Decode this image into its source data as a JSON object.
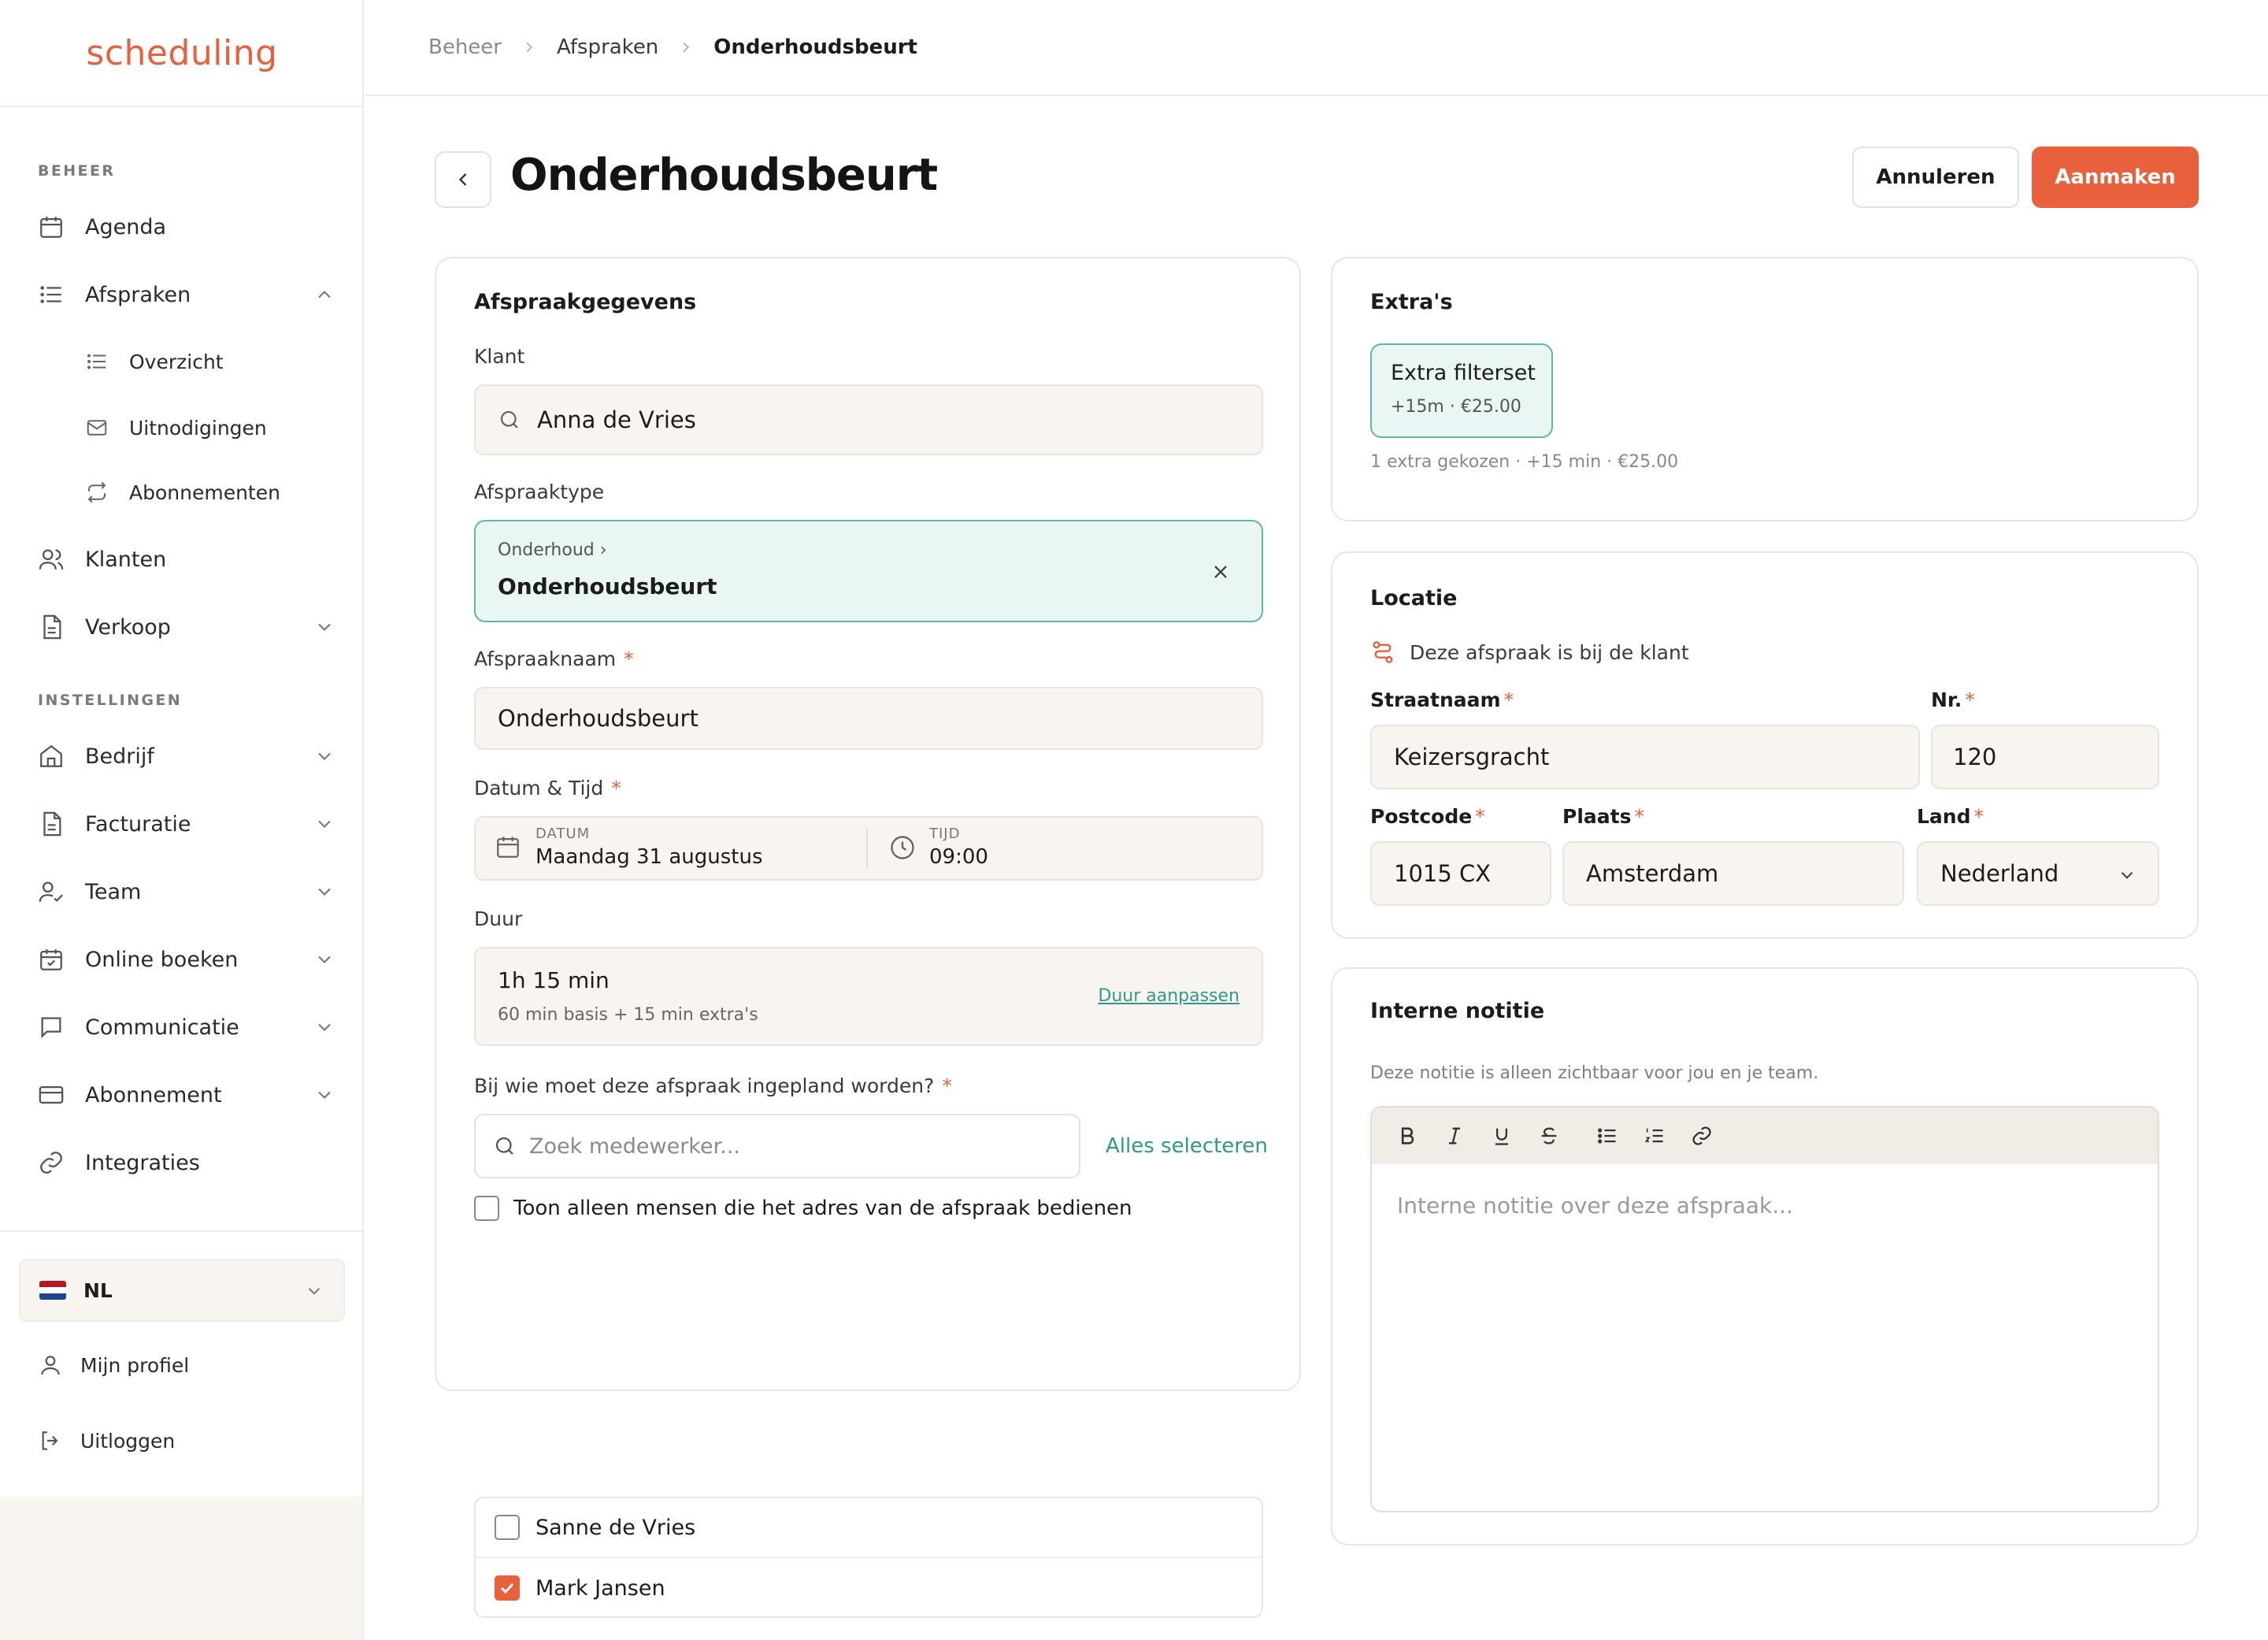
{
  "brand": {
    "logo_text": "scheduling",
    "accent": "#e8603c",
    "teal": "#5eb8a4"
  },
  "sidebar": {
    "section_beheer": "BEHEER",
    "section_instellingen": "INSTELLINGEN",
    "items": {
      "agenda": "Agenda",
      "afspraken": "Afspraken",
      "overzicht": "Overzicht",
      "uitnodigingen": "Uitnodigingen",
      "abonnementen": "Abonnementen",
      "klanten": "Klanten",
      "verkoop": "Verkoop",
      "bedrijf": "Bedrijf",
      "facturatie": "Facturatie",
      "team": "Team",
      "online_boeken": "Online boeken",
      "communicatie": "Communicatie",
      "abonnement": "Abonnement",
      "integraties": "Integraties"
    },
    "language": "NL",
    "profile": "Mijn profiel",
    "logout": "Uitloggen"
  },
  "breadcrumb": {
    "first": "Beheer",
    "second": "Afspraken",
    "current": "Onderhoudsbeurt"
  },
  "header": {
    "title": "Onderhoudsbeurt",
    "cancel": "Annuleren",
    "create": "Aanmaken"
  },
  "details": {
    "title": "Afspraakgegevens",
    "client_label": "Klant",
    "client_value": "Anna de Vries",
    "type_label": "Afspraaktype",
    "type_parent": "Onderhoud ›",
    "type_value": "Onderhoudsbeurt",
    "name_label": "Afspraaknaam",
    "name_value": "Onderhoudsbeurt",
    "datetime_label": "Datum & Tijd",
    "date_caption": "DATUM",
    "date_value": "Maandag 31 augustus",
    "time_caption": "TIJD",
    "time_value": "09:00",
    "duration_label": "Duur",
    "duration_value": "1h 15 min",
    "duration_detail": "60 min basis + 15 min extra's",
    "duration_link": "Duur aanpassen",
    "assign_label": "Bij wie moet deze afspraak ingepland worden?",
    "search_placeholder": "Zoek medewerker...",
    "select_all": "Alles selecteren",
    "only_address": "Toon alleen mensen die het adres van de afspraak bedienen",
    "staff": [
      {
        "name": "Sanne de Vries",
        "checked": false
      },
      {
        "name": "Mark Jansen",
        "checked": true
      }
    ]
  },
  "extras": {
    "title": "Extra's",
    "chip_name": "Extra filterset",
    "chip_detail": "+15m · €25.00",
    "summary": "1 extra gekozen · +15 min · €25.00"
  },
  "location": {
    "title": "Locatie",
    "at_client": "Deze afspraak is bij de klant",
    "street_label": "Straatnaam",
    "street_value": "Keizersgracht",
    "nr_label": "Nr.",
    "nr_value": "120",
    "postcode_label": "Postcode",
    "postcode_value": "1015 CX",
    "city_label": "Plaats",
    "city_value": "Amsterdam",
    "country_label": "Land",
    "country_value": "Nederland"
  },
  "note": {
    "title": "Interne notitie",
    "hint": "Deze notitie is alleen zichtbaar voor jou en je team.",
    "placeholder": "Interne notitie over deze afspraak..."
  }
}
